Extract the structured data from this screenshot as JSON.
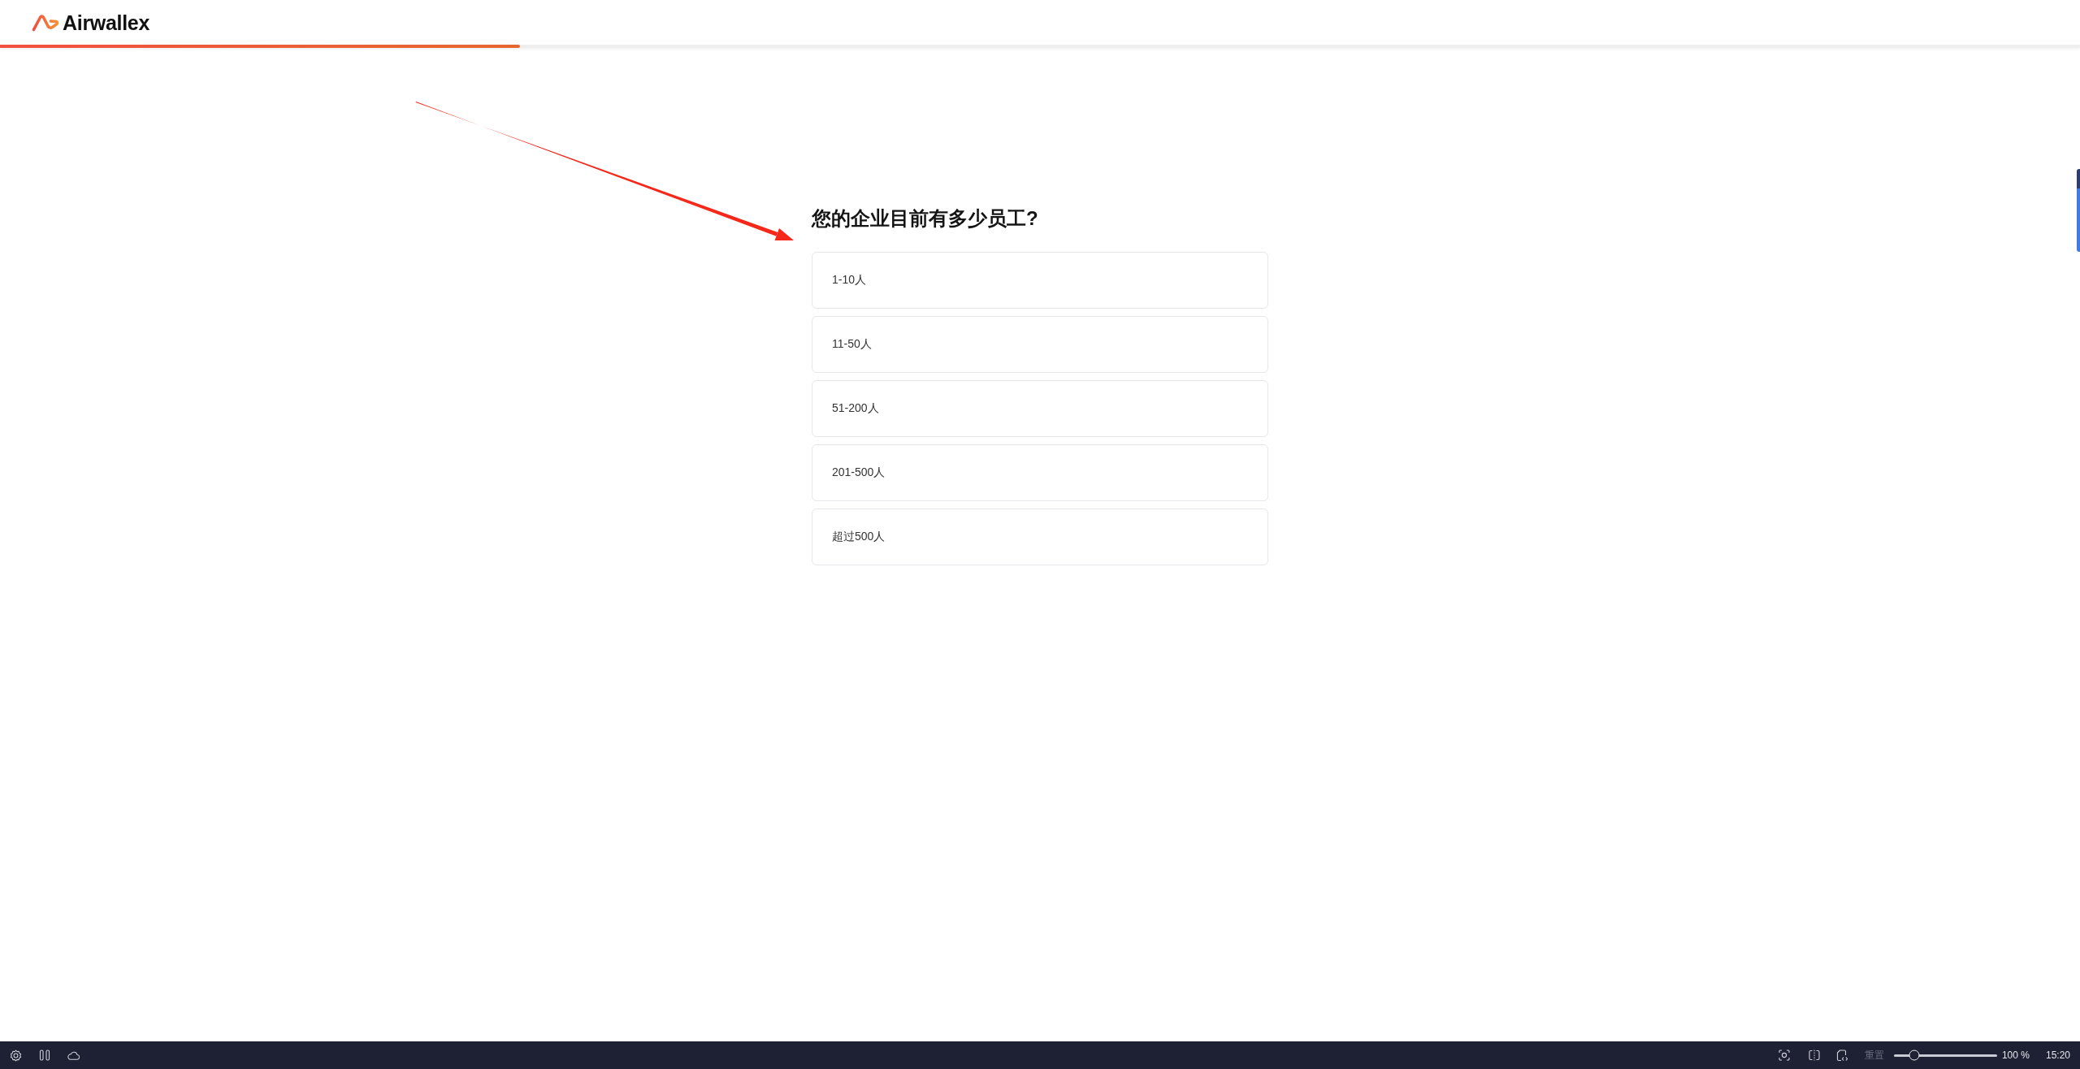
{
  "header": {
    "logo_text": "Airwallex",
    "progress": {
      "level": 0.25
    }
  },
  "question": {
    "title": "您的企业目前有多少员工?",
    "options": [
      {
        "label": "1-10人",
        "selected": false
      },
      {
        "label": "11-50人",
        "selected": false
      },
      {
        "label": "51-200人",
        "selected": false
      },
      {
        "label": "201-500人",
        "selected": false
      },
      {
        "label": "超过500人",
        "selected": false
      }
    ]
  },
  "taskbar": {
    "reset_button": {
      "label": "重置",
      "disabled": true
    },
    "zoom_slider": {
      "level": 0.2
    },
    "zoom_reading": "100 %",
    "clock": "15:20"
  }
}
